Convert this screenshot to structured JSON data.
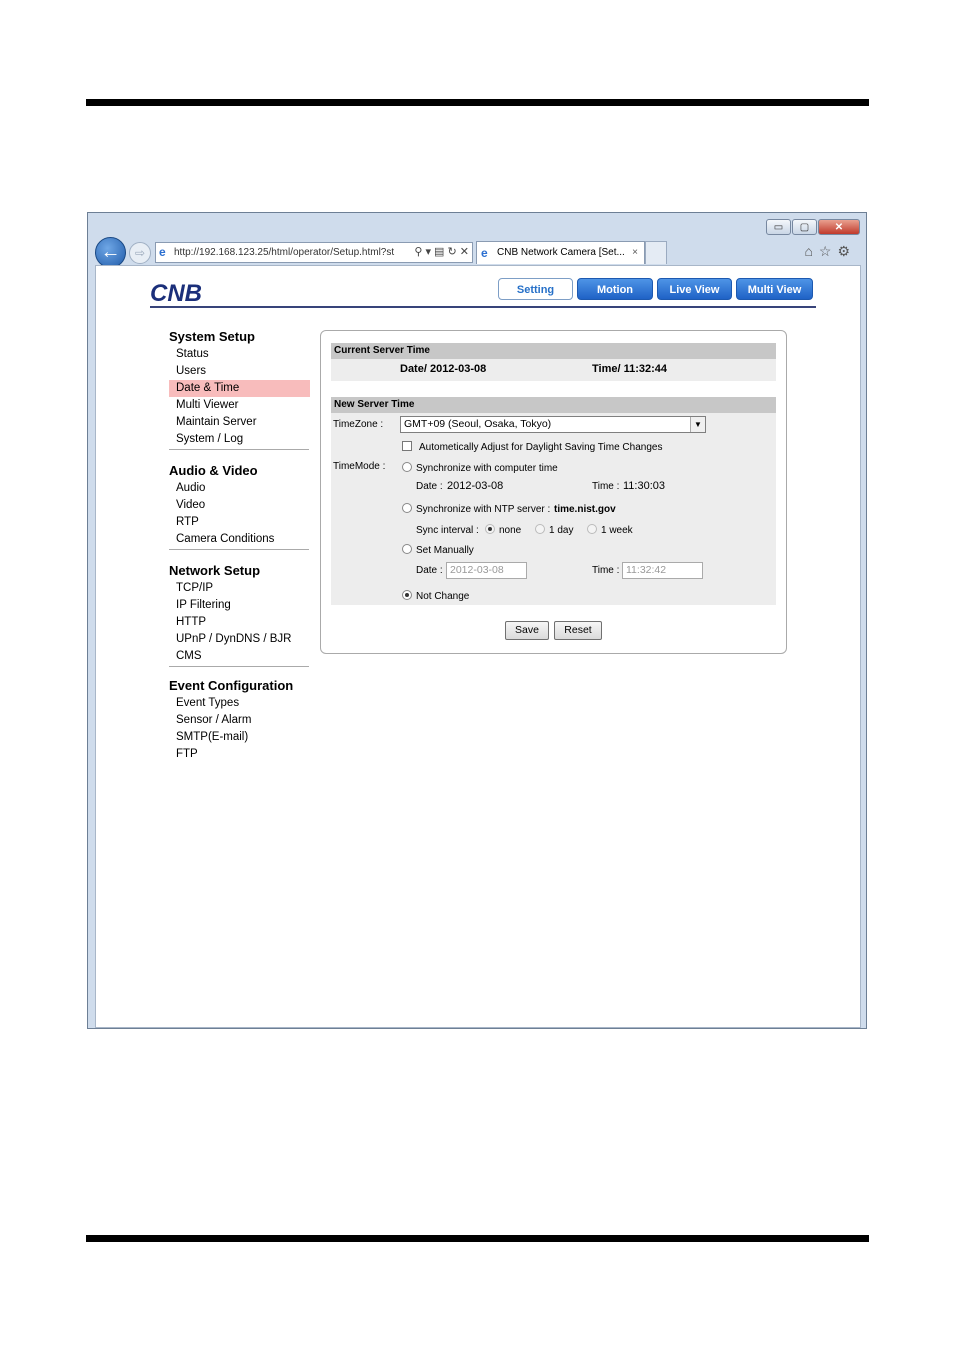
{
  "browser": {
    "address": "http://192.168.123.25/html/operator/Setup.html?st",
    "tab_title": "CNB Network Camera [Set...",
    "tab_close": "×",
    "addr_tools": "⚲ ▾ ▤ ↻ ✕",
    "back": "←",
    "forward": "⇨",
    "win_min": "▭",
    "win_max": "▢",
    "win_close": "✕",
    "right_icons": "⌂☆⚙"
  },
  "header": {
    "logo": "CNB",
    "tabs": [
      "Setting",
      "Motion",
      "Live View",
      "Multi View"
    ],
    "active_tab": "Setting"
  },
  "sidebar": {
    "groups": [
      {
        "title": "System Setup",
        "items": [
          "Status",
          "Users",
          "Date & Time",
          "Multi Viewer",
          "Maintain Server",
          "System / Log"
        ]
      },
      {
        "title": "Audio & Video",
        "items": [
          "Audio",
          "Video",
          "RTP",
          "Camera Conditions"
        ]
      },
      {
        "title": "Network Setup",
        "items": [
          "TCP/IP",
          "IP Filtering",
          "HTTP",
          "UPnP / DynDNS / BJR",
          "CMS"
        ]
      },
      {
        "title": "Event Configuration",
        "items": [
          "Event Types",
          "Sensor / Alarm",
          "SMTP(E-mail)",
          "FTP"
        ]
      }
    ],
    "selected": "Date & Time"
  },
  "current": {
    "title": "Current Server Time",
    "date": "Date/ 2012-03-08",
    "time": "Time/ 11:32:44"
  },
  "new": {
    "title": "New Server Time",
    "timezone_label": "TimeZone :",
    "timezone_value": "GMT+09 (Seoul, Osaka, Tokyo)",
    "dst_label": "Autometically Adjust for Daylight Saving Time Changes",
    "timemode_label": "TimeMode :",
    "sync_computer": "Synchronize with computer time",
    "comp_date_label": "Date :",
    "comp_date": "2012-03-08",
    "comp_time_label": "Time :",
    "comp_time": "11:30:03",
    "sync_ntp": "Synchronize with NTP server :",
    "ntp_server": "time.nist.gov",
    "sync_interval_label": "Sync interval :",
    "interval_options": [
      "none",
      "1 day",
      "1 week"
    ],
    "set_manually": "Set Manually",
    "man_date_label": "Date :",
    "man_date": "2012-03-08",
    "man_time_label": "Time :",
    "man_time": "11:32:42",
    "not_change": "Not Change",
    "selected_mode": "Not Change"
  },
  "buttons": {
    "save": "Save",
    "reset": "Reset"
  },
  "colors": {
    "tab_blue": "#1f62c6",
    "selected_bg": "#f8bcbc",
    "header_line": "#38447a",
    "section_header": "#c7c7c7"
  }
}
